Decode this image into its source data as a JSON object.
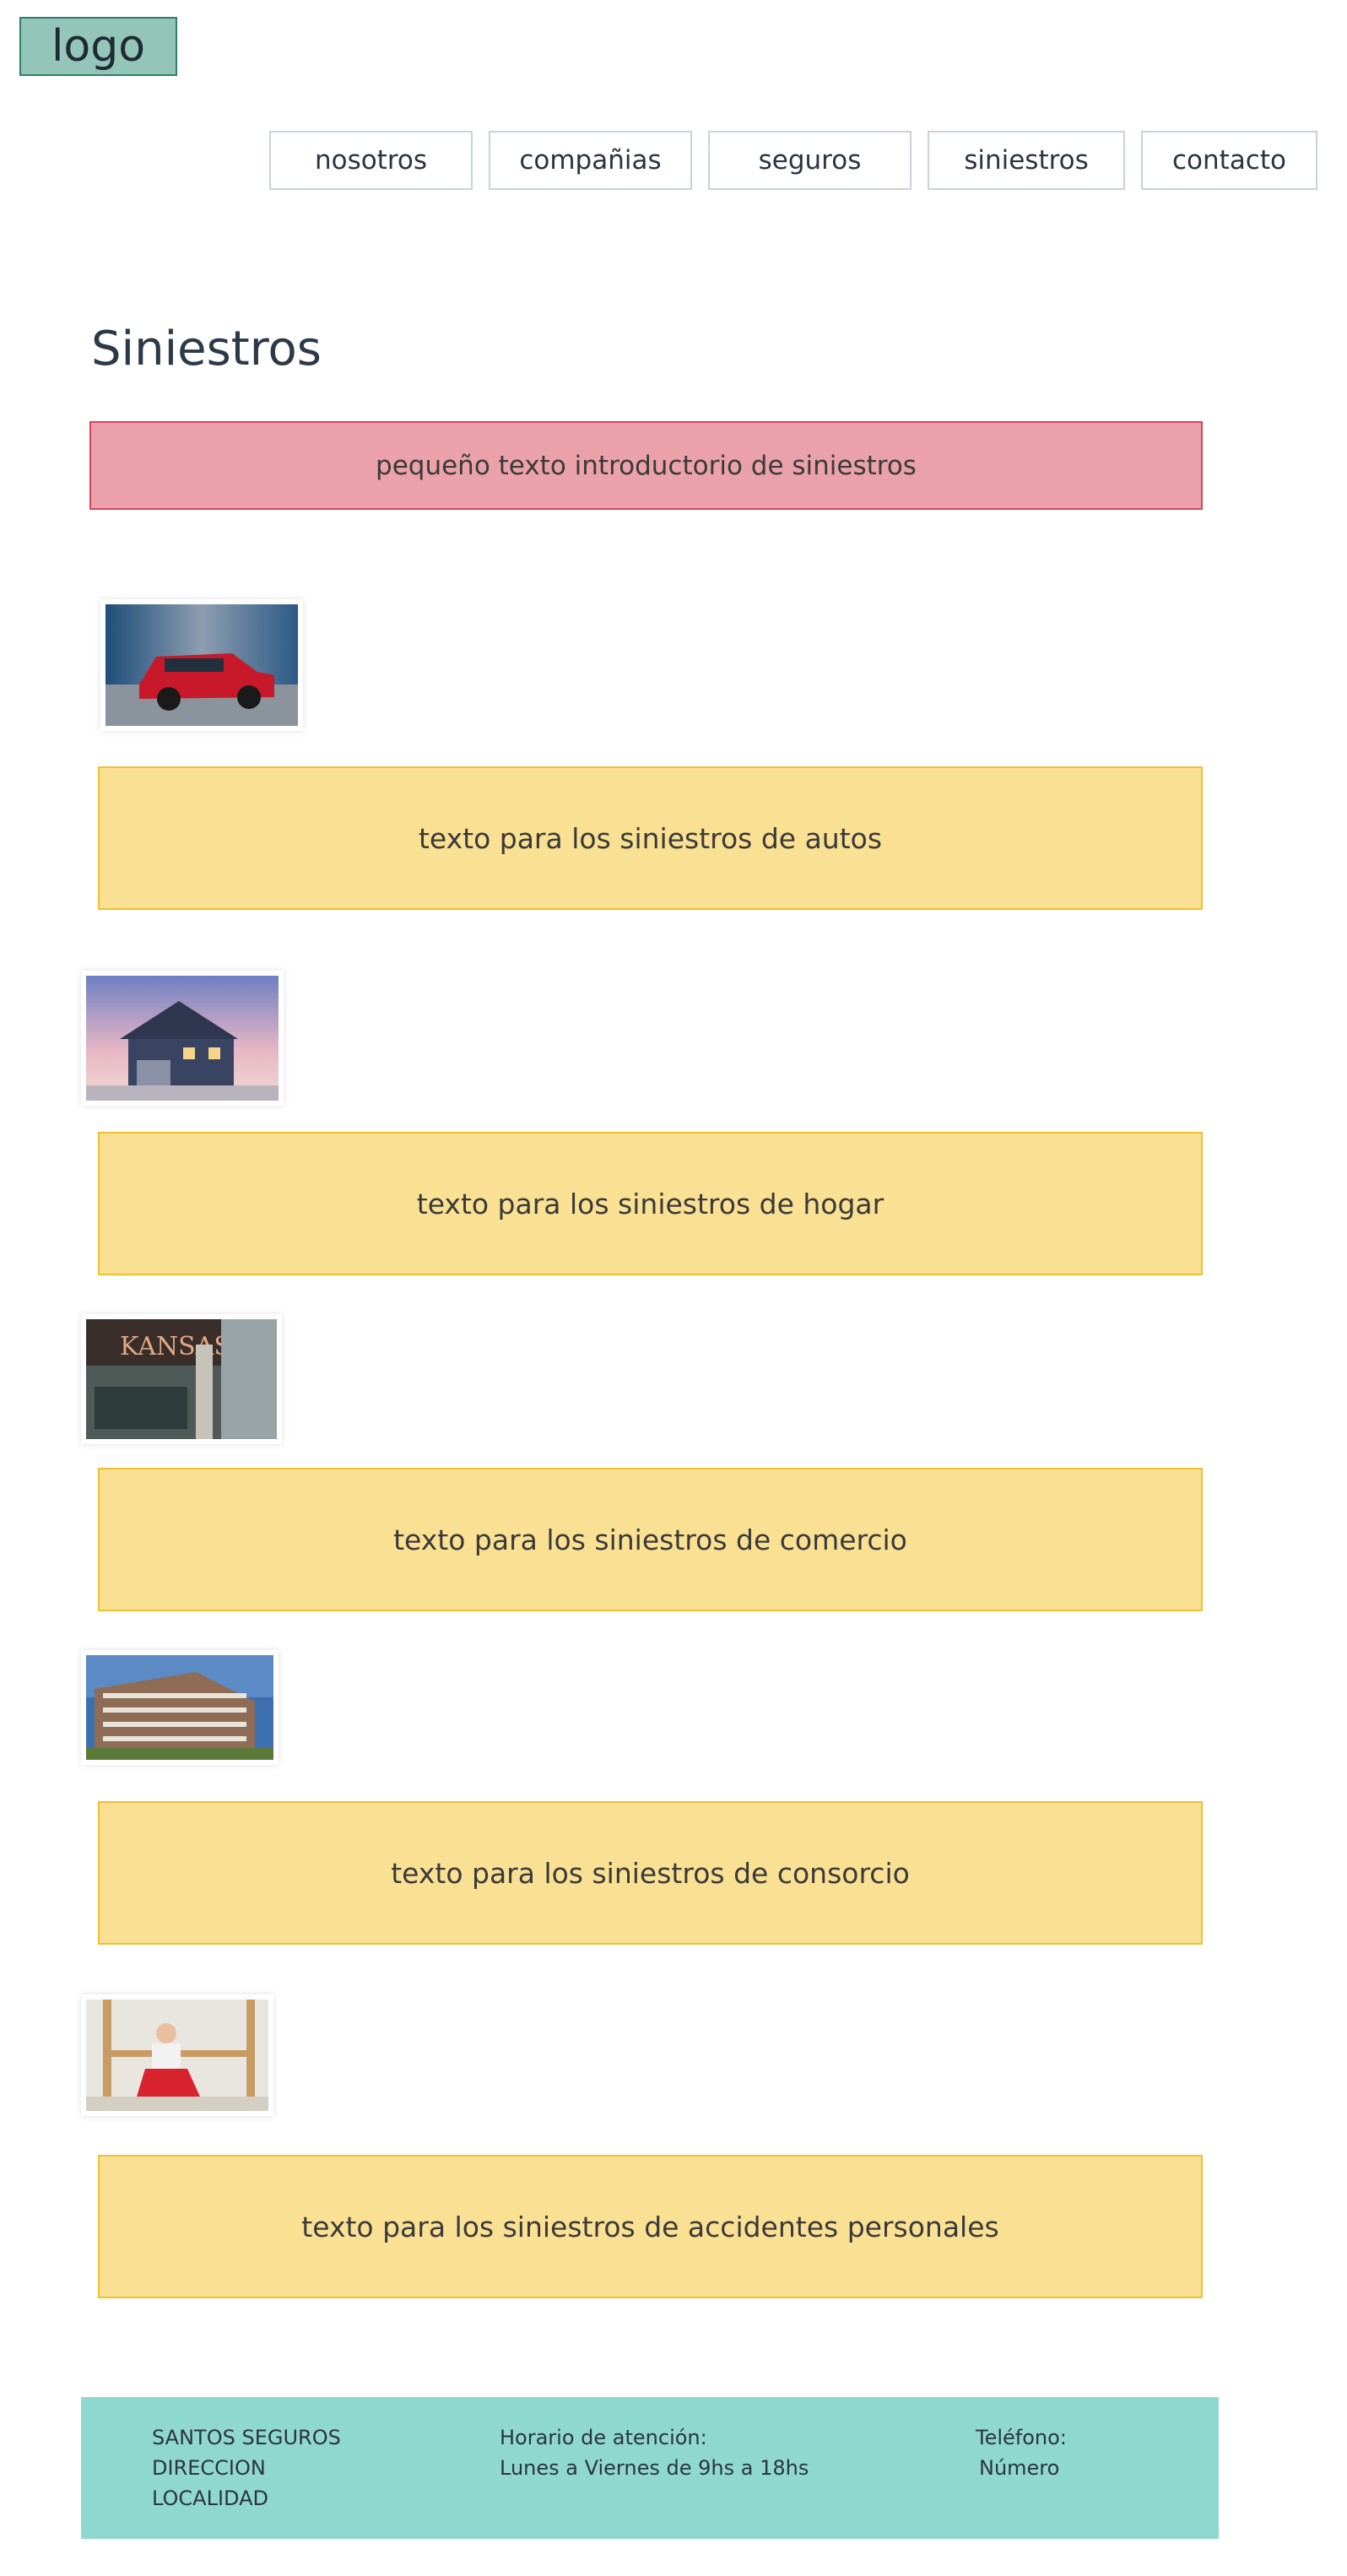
{
  "header": {
    "logo_text": "logo"
  },
  "nav": {
    "items": [
      {
        "label": "nosotros"
      },
      {
        "label": "compañias"
      },
      {
        "label": "seguros"
      },
      {
        "label": "siniestros"
      },
      {
        "label": "contacto"
      }
    ]
  },
  "main": {
    "title": "Siniestros",
    "intro": "pequeño texto introductorio de siniestros",
    "sections": [
      {
        "image": "red-suv-car-image",
        "text": "texto para los siniestros de autos"
      },
      {
        "image": "house-image",
        "text": "texto para los siniestros de hogar"
      },
      {
        "image": "storefront-image",
        "text": "texto para los siniestros de comercio",
        "image_sign_text": "KANSAS"
      },
      {
        "image": "apartment-building-image",
        "text": "texto para los siniestros de consorcio"
      },
      {
        "image": "injured-worker-image",
        "text": "texto para los siniestros de accidentes personales"
      }
    ]
  },
  "footer": {
    "company": [
      "SANTOS SEGUROS",
      "DIRECCION",
      "LOCALIDAD"
    ],
    "hours": [
      "Horario de atención:",
      "Lunes a Viernes de 9hs a 18hs"
    ],
    "phone": [
      "Teléfono:",
      "Número"
    ]
  },
  "colors": {
    "logo_bg": "#93c5b9",
    "intro_bg": "#eaa1aa",
    "intro_border": "#d9445a",
    "section_bg": "#f9e092",
    "section_border": "#f2bf30",
    "footer_bg": "#8fd8cf"
  }
}
